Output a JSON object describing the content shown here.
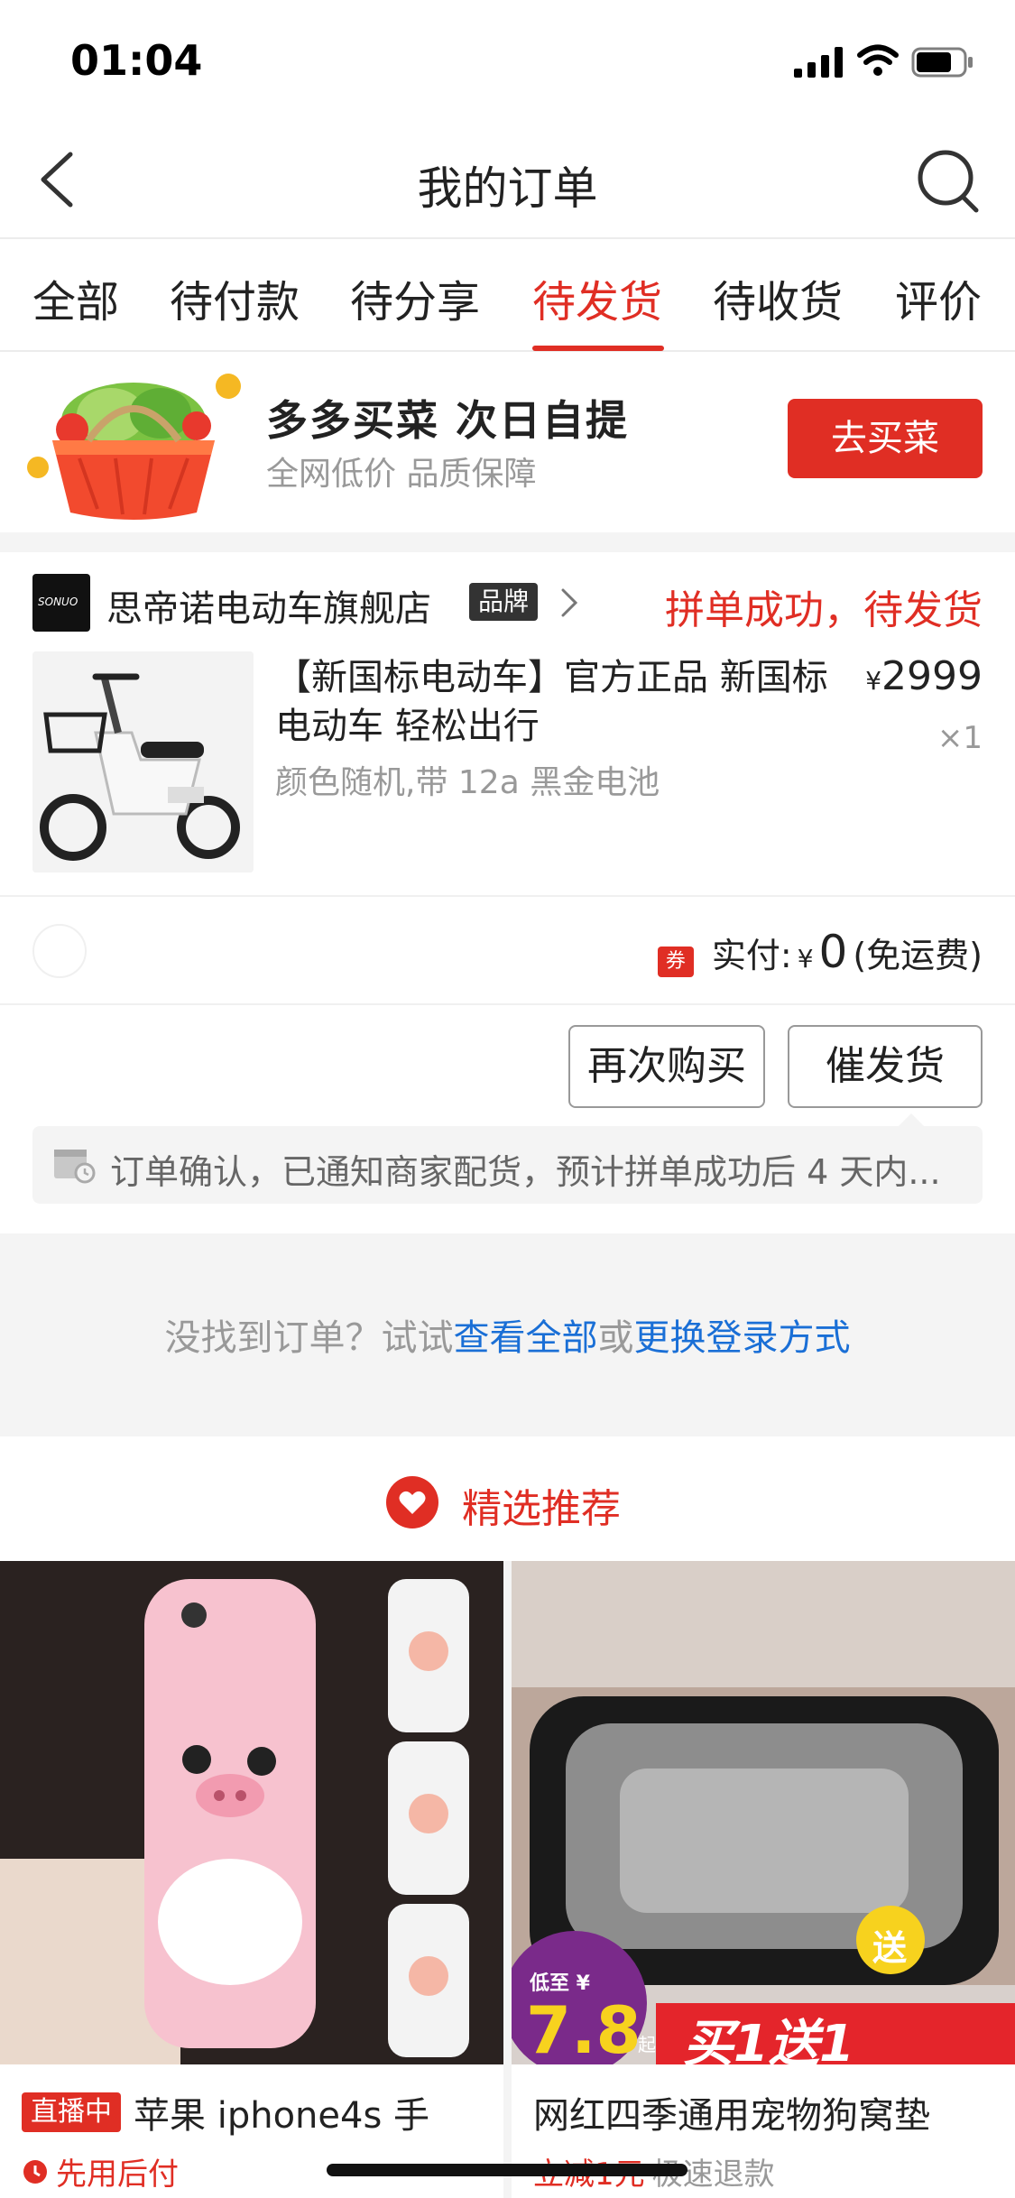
{
  "status_bar": {
    "time": "01:04"
  },
  "nav": {
    "title": "我的订单"
  },
  "tabs": [
    {
      "label": "全部"
    },
    {
      "label": "待付款"
    },
    {
      "label": "待分享"
    },
    {
      "label": "待发货"
    },
    {
      "label": "待收货"
    },
    {
      "label": "评价"
    }
  ],
  "active_tab": "待发货",
  "banner": {
    "title": "多多买菜 次日自提",
    "subtitle": "全网低价 品质保障",
    "button": "去买菜"
  },
  "order": {
    "store_logo_text": "SONUO",
    "store_name": "思帝诺电动车旗舰店",
    "brand_badge": "品牌",
    "status": "拼单成功，待发货",
    "product_title": "【新国标电动车】官方正品 新国标电动车 轻松出行",
    "spec": "颜色随机,带 12a 黑金电池",
    "price_symbol": "¥",
    "price": "2999",
    "quantity": "×1",
    "coupon_tag": "券",
    "paid_label": "实付:",
    "paid_symbol": "¥",
    "paid_amount": "0",
    "shipping_note": "(免运费)",
    "rebuy_button": "再次购买",
    "urge_button": "催发货",
    "notice": "订单确认，已通知商家配货，预计拼单成功后 4 天内..."
  },
  "not_found": {
    "prefix": "没找到订单？试试",
    "link1": "查看全部",
    "middle": "或",
    "link2": "更换登录方式"
  },
  "recommend": {
    "title": "精选推荐"
  },
  "products": [
    {
      "badge": "直播中",
      "title": "苹果 iphone4s 手",
      "sub1": "先用后付"
    },
    {
      "title": "网红四季通用宠物狗窝垫",
      "sub1": "立减1元",
      "sub2": "极速退款",
      "promo_low": "低至 ¥",
      "promo_price": "7.8",
      "promo_qi": "起",
      "promo_banner": "买1送1",
      "promo_gift": "送"
    }
  ],
  "colors": {
    "accent": "#e02e24",
    "link": "#1a6fd6"
  }
}
